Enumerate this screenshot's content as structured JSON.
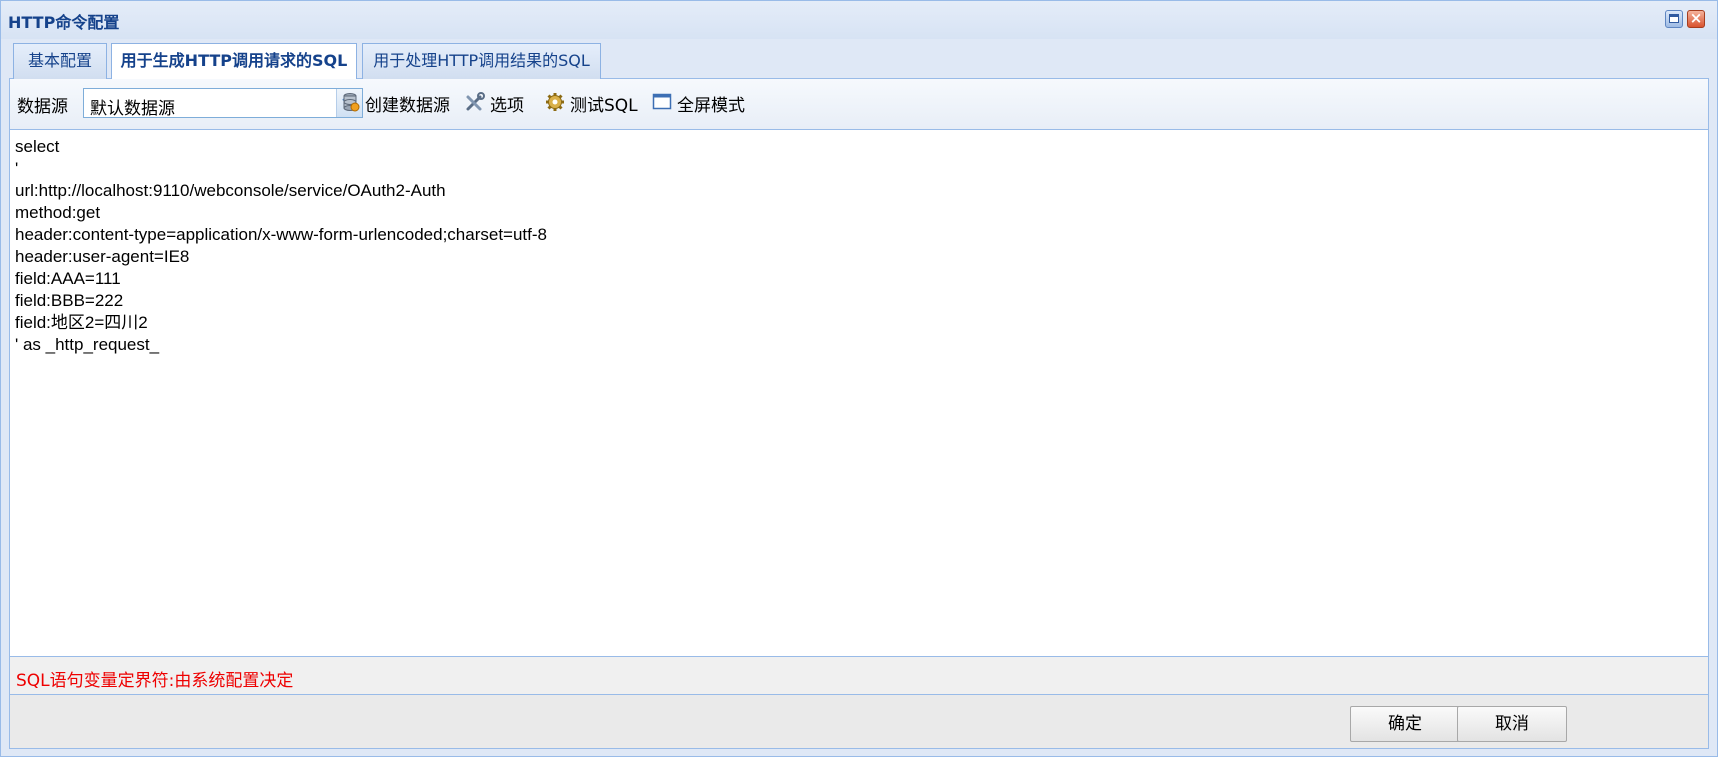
{
  "window": {
    "title": "HTTP命令配置"
  },
  "tabs": [
    {
      "label": "基本配置",
      "active": false
    },
    {
      "label": "用于生成HTTP调用请求的SQL",
      "active": true
    },
    {
      "label": "用于处理HTTP调用结果的SQL",
      "active": false
    }
  ],
  "toolbar": {
    "datasource_label": "数据源",
    "datasource_value": "默认数据源",
    "buttons": [
      {
        "label": "创建数据源",
        "icon": "database-icon"
      },
      {
        "label": "选项",
        "icon": "tools-icon"
      },
      {
        "label": "测试SQL",
        "icon": "gear-icon"
      },
      {
        "label": "全屏模式",
        "icon": "window-icon"
      }
    ]
  },
  "editor": {
    "lines": [
      "select",
      "'",
      "url:http://localhost:9110/webconsole/service/OAuth2-Auth",
      "method:get",
      "header:content-type=application/x-www-form-urlencoded;charset=utf-8",
      "header:user-agent=IE8",
      "field:AAA=111",
      "field:BBB=222",
      "field:地区2=四川2",
      "' as _http_request_"
    ]
  },
  "status": {
    "text": "SQL语句变量定界符:由系统配置决定",
    "color": "#ee0000"
  },
  "footer": {
    "ok_label": "确定",
    "cancel_label": "取消"
  }
}
